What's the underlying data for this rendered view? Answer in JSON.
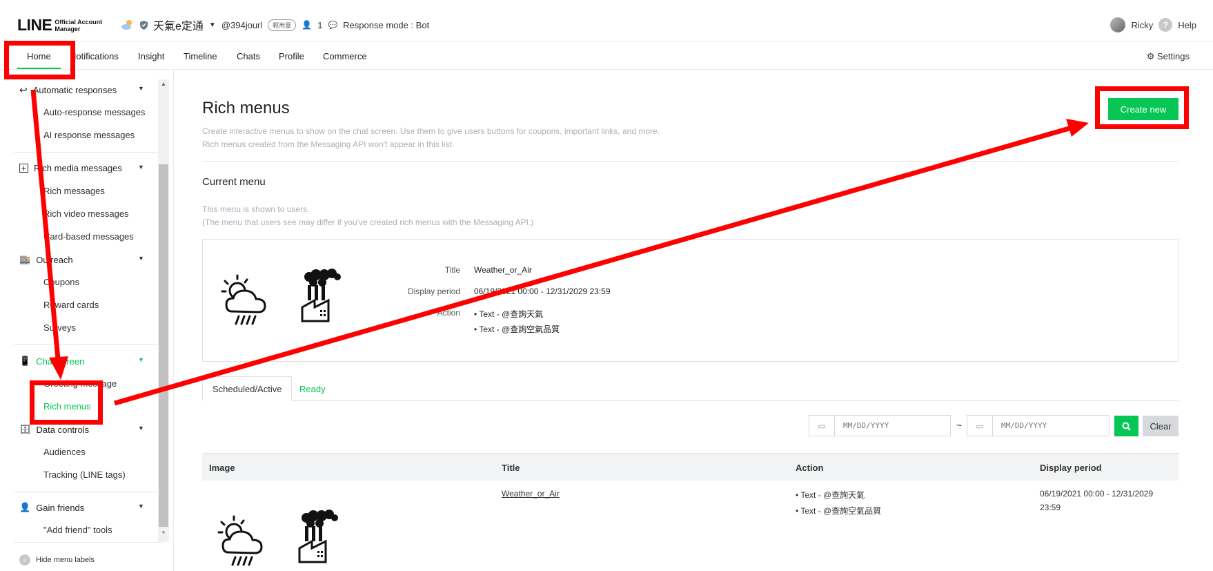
{
  "header": {
    "logo_main": "LINE",
    "logo_sub_1": "Official Account",
    "logo_sub_2": "Manager",
    "account_name": "天氣e定通",
    "account_id": "@394jourl",
    "plan_tag": "輕用量",
    "friends_count": "1",
    "response_mode": "Response mode : Bot",
    "user_name": "Ricky",
    "help_label": "Help"
  },
  "nav": {
    "tabs": [
      {
        "label": "Home"
      },
      {
        "label": "Notifications"
      },
      {
        "label": "Insight"
      },
      {
        "label": "Timeline"
      },
      {
        "label": "Chats"
      },
      {
        "label": "Profile"
      },
      {
        "label": "Commerce"
      }
    ],
    "settings_label": "Settings"
  },
  "sidebar": {
    "groups": [
      {
        "label": "Automatic responses",
        "items": [
          "Auto-response messages",
          "AI response messages"
        ]
      },
      {
        "label": "Rich media messages",
        "items": [
          "Rich messages",
          "Rich video messages",
          "Card-based messages"
        ]
      },
      {
        "label": "Outreach",
        "items": [
          "Coupons",
          "Reward cards",
          "Surveys"
        ]
      },
      {
        "label": "Chat screen",
        "items": [
          "Greeting message",
          "Rich menus"
        ]
      },
      {
        "label": "Data controls",
        "items": [
          "Audiences",
          "Tracking (LINE tags)"
        ]
      },
      {
        "label": "Gain friends",
        "items": [
          "\"Add friend\" tools"
        ]
      }
    ],
    "hide_labels": "Hide menu labels"
  },
  "main": {
    "title": "Rich menus",
    "desc_1": "Create interactive menus to show on the chat screen. Use them to give users buttons for coupons, important links, and more.",
    "desc_2": "Rich menus created from the Messaging API won't appear in this list.",
    "create_button": "Create new",
    "current_menu": {
      "heading": "Current menu",
      "note_1": "This menu is shown to users.",
      "note_2": "(The menu that users see may differ if you've created rich menus with the Messaging API.)",
      "title_label": "Title",
      "title_value": "Weather_or_Air",
      "period_label": "Display period",
      "period_value": "06/19/2021 00:00 - 12/31/2029 23:59",
      "action_label": "Action",
      "actions": [
        "Text - @查詢天氣",
        "Text - @查詢空氣品質"
      ]
    },
    "tabs": [
      "Scheduled/Active",
      "Ready"
    ],
    "date_placeholder": "MM/DD/YYYY",
    "tilde": "~",
    "clear_button": "Clear",
    "table": {
      "headers": [
        "Image",
        "Title",
        "Action",
        "Display period"
      ],
      "rows": [
        {
          "title": "Weather_or_Air",
          "actions": [
            "Text - @查詢天氣",
            "Text - @查詢空氣品質"
          ],
          "period_1": "06/19/2021 00:00 - 12/31/2029",
          "period_2": "23:59"
        }
      ]
    }
  },
  "colors": {
    "accent": "#06c755",
    "annotation": "#ff0000"
  }
}
